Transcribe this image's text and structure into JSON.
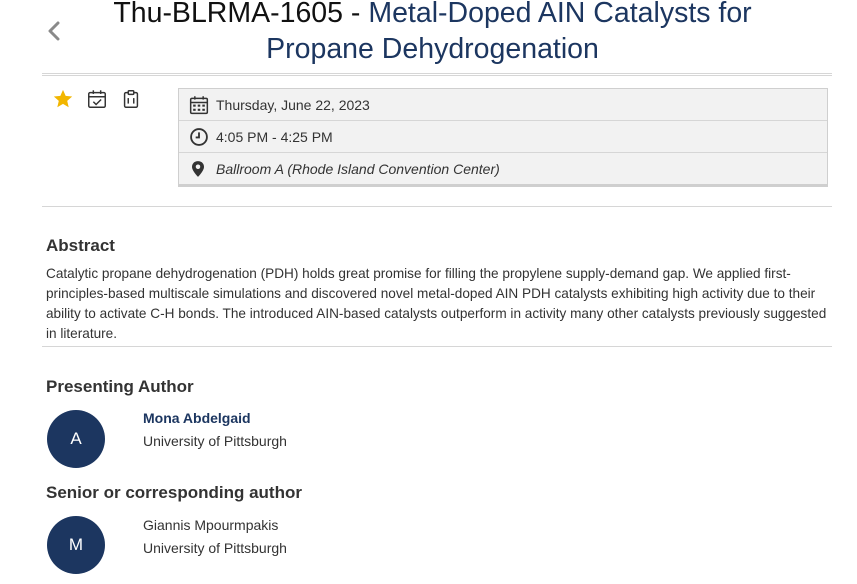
{
  "header": {
    "code": "Thu-BLRMA-1605 - ",
    "title": "Metal-Doped AIN Catalysts for Propane Dehydrogenation"
  },
  "actions": [
    {
      "icon": "star-icon",
      "color": "#f2b600"
    },
    {
      "icon": "calendar-check-icon"
    },
    {
      "icon": "clipboard-icon"
    }
  ],
  "info": {
    "date": "Thursday, June 22, 2023",
    "time": "4:05 PM - 4:25 PM",
    "location": "Ballroom A (Rhode Island Convention Center)"
  },
  "abstract": {
    "heading": "Abstract",
    "text": "Catalytic propane dehydrogenation (PDH) holds great promise for filling the propylene supply-demand gap. We applied first-principles-based multiscale simulations and discovered novel metal-doped AIN PDH catalysts exhibiting high activity due to their ability to activate C-H bonds. The introduced AIN-based catalysts outperform in activity many other catalysts previously suggested in literature."
  },
  "presenting": {
    "heading": "Presenting Author",
    "initial": "A",
    "name": "Mona Abdelgaid",
    "affiliation": "University of Pittsburgh"
  },
  "senior": {
    "heading": "Senior or corresponding author",
    "initial": "M",
    "name": "Giannis Mpourmpakis",
    "affiliation": "University of Pittsburgh"
  },
  "colors": {
    "accent": "#1c3660",
    "star": "#f2b600"
  }
}
